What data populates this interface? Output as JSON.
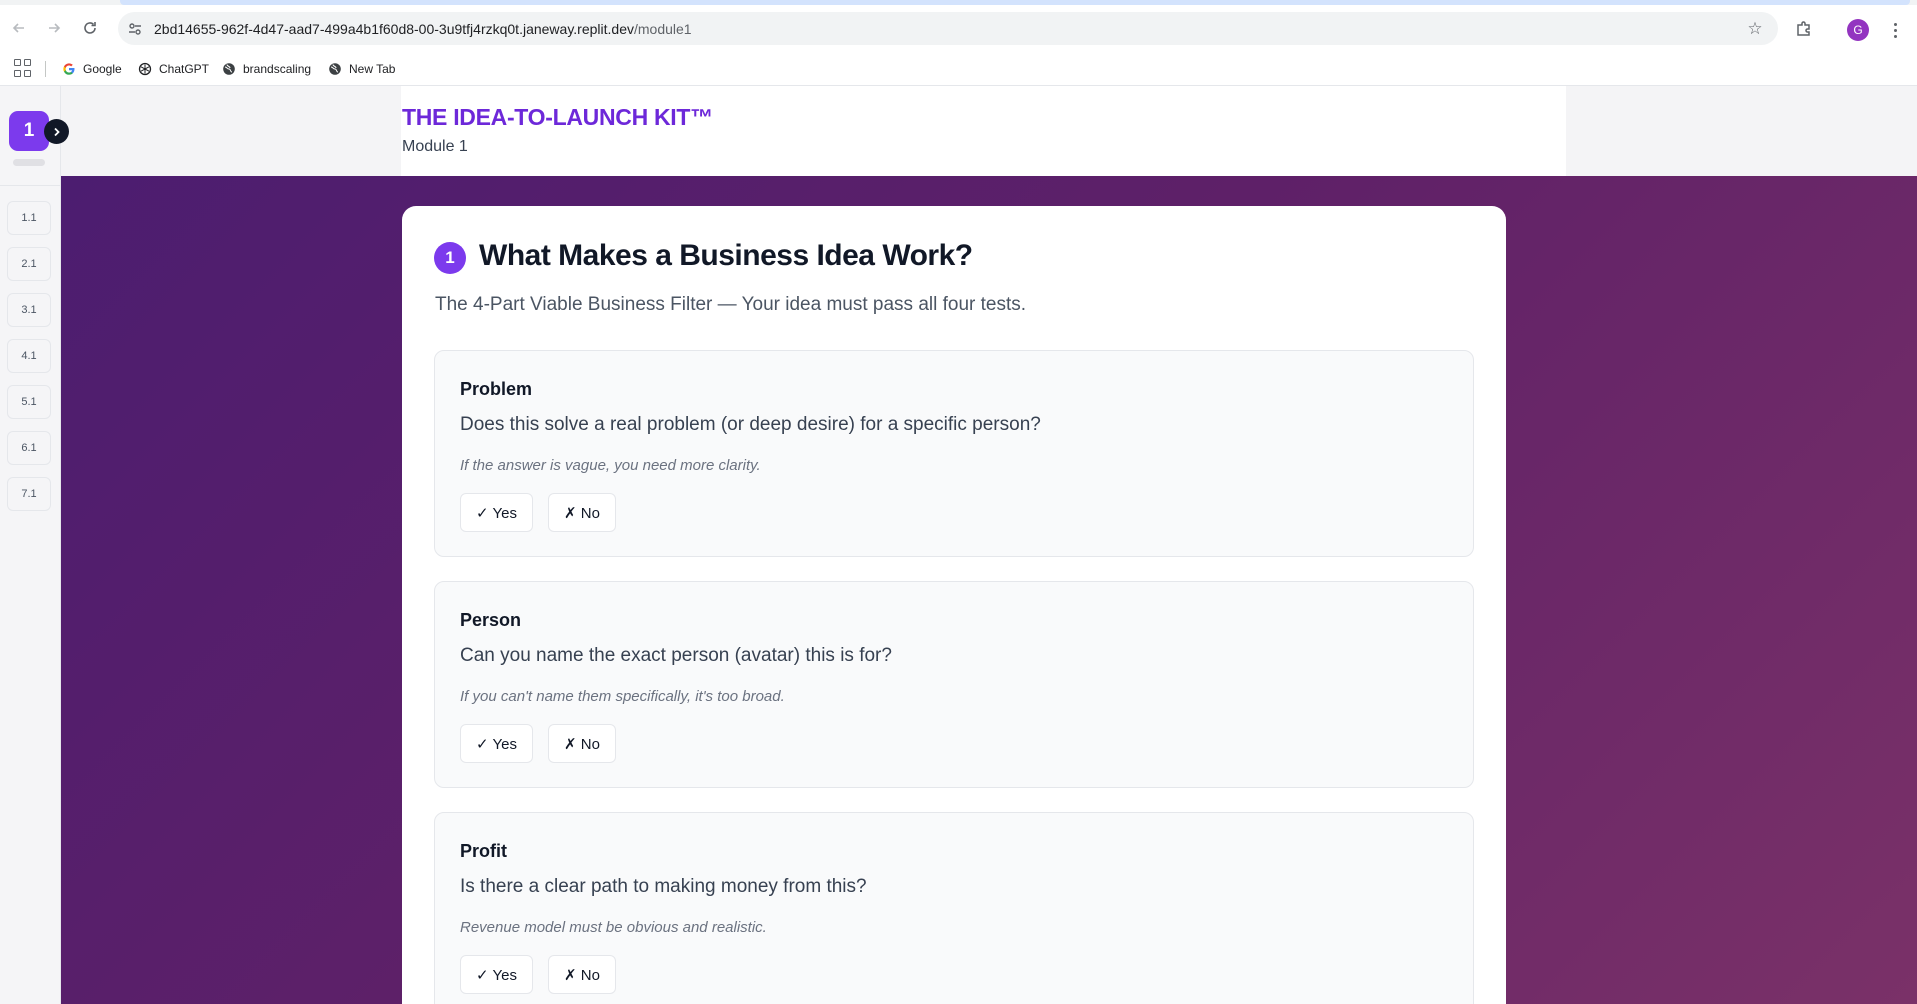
{
  "browser": {
    "url_host": "2bd14655-962f-4d47-aad7-499a4b1f60d8-00-3u9tfj4rzkq0t.janeway.replit.dev",
    "url_path": "/module1",
    "profile_initial": "G",
    "icons": [
      "back-icon",
      "forward-icon",
      "reload-icon",
      "site-info-icon",
      "star-icon",
      "extensions-icon",
      "menu-icon"
    ]
  },
  "bookmarks": [
    {
      "label": "Google",
      "icon": "google-icon"
    },
    {
      "label": "ChatGPT",
      "icon": "chatgpt-icon"
    },
    {
      "label": "brandscaling",
      "icon": "globe-icon"
    },
    {
      "label": "New Tab",
      "icon": "globe-icon"
    }
  ],
  "sidebar": {
    "module_badge": "1",
    "lessons": [
      "1.1",
      "2.1",
      "3.1",
      "4.1",
      "5.1",
      "6.1",
      "7.1"
    ]
  },
  "header": {
    "title": "THE IDEA-TO-LAUNCH KIT™",
    "subtitle": "Module 1"
  },
  "card": {
    "number": "1",
    "title": "What Makes a Business Idea Work?",
    "description": "The 4-Part Viable Business Filter — Your idea must pass all four tests.",
    "tests": [
      {
        "title": "Problem",
        "question": "Does this solve a real problem (or deep desire) for a specific person?",
        "hint": "If the answer is vague, you need more clarity.",
        "yes": "✓ Yes",
        "no": "✗ No"
      },
      {
        "title": "Person",
        "question": "Can you name the exact person (avatar) this is for?",
        "hint": "If you can't name them specifically, it's too broad.",
        "yes": "✓ Yes",
        "no": "✗ No"
      },
      {
        "title": "Profit",
        "question": "Is there a clear path to making money from this?",
        "hint": "Revenue model must be obvious and realistic.",
        "yes": "✓ Yes",
        "no": "✗ No"
      }
    ]
  },
  "colors": {
    "accent": "#7c3aed",
    "hero_start": "#4c1d70",
    "hero_end": "#7a3168"
  }
}
